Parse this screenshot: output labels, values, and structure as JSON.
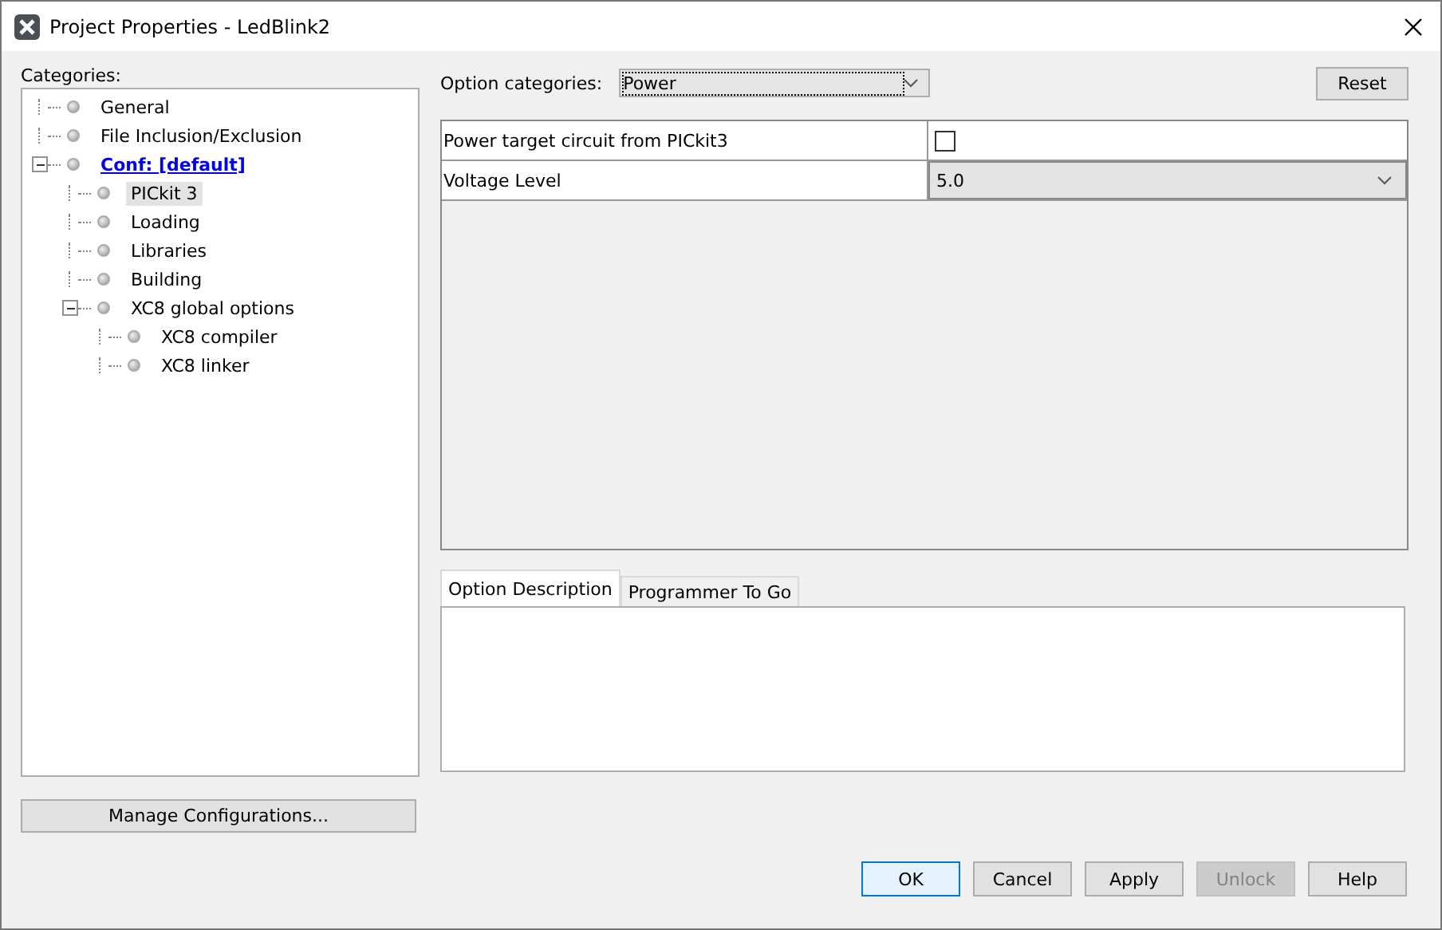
{
  "window": {
    "title": "Project Properties - LedBlink2"
  },
  "categories": {
    "label": "Categories:",
    "items": [
      {
        "label": "General",
        "active": false,
        "selected": false
      },
      {
        "label": "File Inclusion/Exclusion",
        "active": false,
        "selected": false
      },
      {
        "label": "Conf: [default]",
        "active": true,
        "selected": false,
        "expanded": true,
        "children": [
          {
            "label": "PICkit 3",
            "active": false,
            "selected": true
          },
          {
            "label": "Loading",
            "active": false,
            "selected": false
          },
          {
            "label": "Libraries",
            "active": false,
            "selected": false
          },
          {
            "label": "Building",
            "active": false,
            "selected": false
          },
          {
            "label": "XC8 global options",
            "active": false,
            "selected": false,
            "expanded": true,
            "children": [
              {
                "label": "XC8 compiler",
                "active": false,
                "selected": false
              },
              {
                "label": "XC8 linker",
                "active": false,
                "selected": false
              }
            ]
          }
        ]
      }
    ]
  },
  "manage_button": "Manage Configurations...",
  "option_categories": {
    "label": "Option categories:",
    "value": "Power"
  },
  "reset_button": "Reset",
  "properties": [
    {
      "kind": "checkbox",
      "name": "Power target circuit from PICkit3",
      "checked": false
    },
    {
      "kind": "dropdown",
      "name": "Voltage Level",
      "value": "5.0"
    }
  ],
  "tabs": [
    {
      "label": "Option Description",
      "selected": true
    },
    {
      "label": "Programmer To Go",
      "selected": false
    }
  ],
  "buttons": [
    {
      "label": "OK",
      "default": true,
      "disabled": false
    },
    {
      "label": "Cancel",
      "default": false,
      "disabled": false
    },
    {
      "label": "Apply",
      "default": false,
      "disabled": false
    },
    {
      "label": "Unlock",
      "default": false,
      "disabled": true
    },
    {
      "label": "Help",
      "default": false,
      "disabled": false
    }
  ]
}
